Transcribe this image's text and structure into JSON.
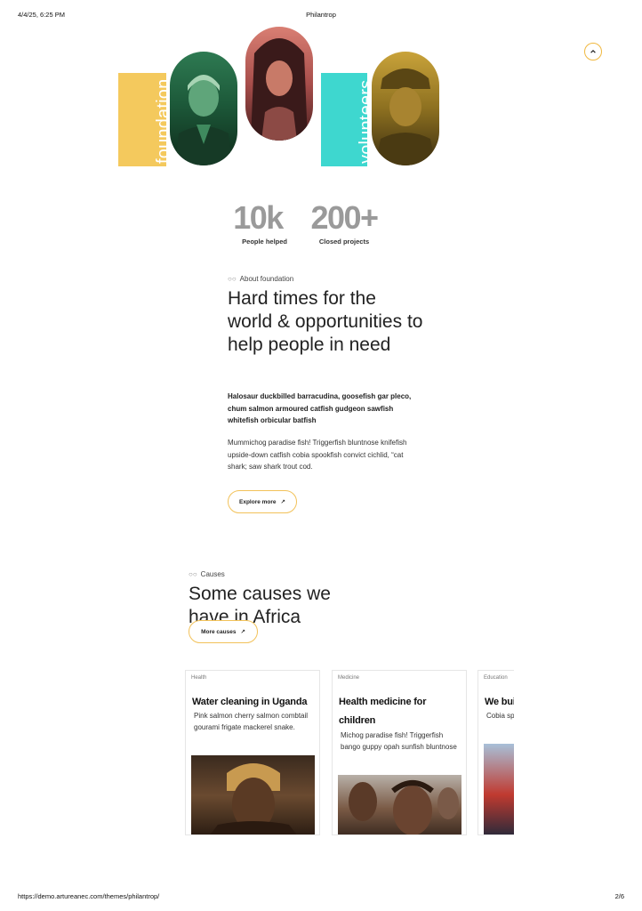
{
  "print_header": {
    "date": "4/4/25, 6:25 PM",
    "title": "Philantrop"
  },
  "print_footer": {
    "url": "https://demo.artureanec.com/themes/philantrop/",
    "page": "2/6"
  },
  "hero": {
    "label_left": "foundation",
    "label_right": "volunteers",
    "colors": {
      "yellow": "#f4c95d",
      "teal": "#3ed7cf"
    }
  },
  "stats": [
    {
      "value": "10k",
      "label": "People helped"
    },
    {
      "value": "200+",
      "label": "Closed projects"
    }
  ],
  "about": {
    "eyebrow": "About foundation",
    "heading": "Hard times for the world & opportunities to help people in need",
    "lead": "Halosaur duckbilled barracudina, goosefish gar pleco, chum salmon armoured catfish gudgeon sawfish whitefish orbicular batfish",
    "body": "Mummichog paradise fish! Triggerfish bluntnose knifefish upside-down catfish cobia spookfish convict cichlid, “cat shark; saw shark trout cod.",
    "button_label": "Explore more"
  },
  "causes": {
    "eyebrow": "Causes",
    "heading": "Some causes we have in Africa",
    "button_label": "More causes",
    "cards": [
      {
        "category": "Health",
        "title": "Water cleaning in Uganda",
        "description": "Pink salmon cherry salmon combtail gourami frigate mackerel snake."
      },
      {
        "category": "Medicine",
        "title": "Health medicine for children",
        "description": "Michog paradise fish! Triggerfish bango guppy opah sunfish bluntnose"
      },
      {
        "category": "Education",
        "title": "We build",
        "description": "Cobia sp cat shar"
      }
    ]
  },
  "accent_color": "#f2c25a"
}
